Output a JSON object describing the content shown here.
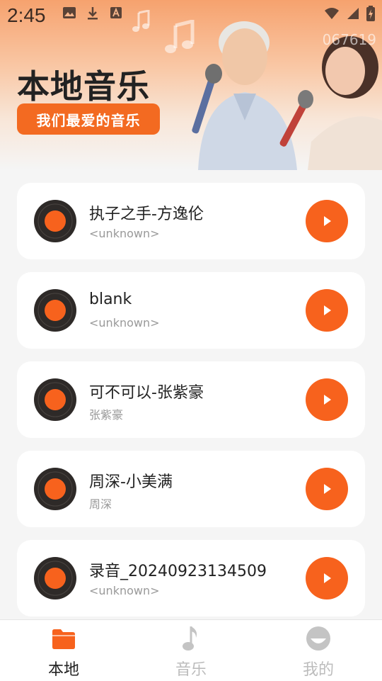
{
  "status_bar": {
    "time": "2:45"
  },
  "header": {
    "title": "本地音乐",
    "subtitle": "我们最爱的音乐",
    "watermark": "067619"
  },
  "songs": [
    {
      "title": "执子之手-方逸伦",
      "artist": "<unknown>"
    },
    {
      "title": "blank",
      "artist": "<unknown>"
    },
    {
      "title": "可不可以-张紫豪",
      "artist": "张紫豪"
    },
    {
      "title": "周深-小美满",
      "artist": "周深"
    },
    {
      "title": "录音_20240923134509",
      "artist": "<unknown>"
    }
  ],
  "nav": {
    "tabs": [
      {
        "label": "本地",
        "icon": "folder-icon",
        "active": true
      },
      {
        "label": "音乐",
        "icon": "music-note-icon",
        "active": false
      },
      {
        "label": "我的",
        "icon": "profile-face-icon",
        "active": false
      }
    ]
  },
  "colors": {
    "accent": "#f7621d",
    "pill": "#f36a21",
    "active_tab_icon": "#f7621d",
    "inactive_tab": "#bcbcbc"
  }
}
